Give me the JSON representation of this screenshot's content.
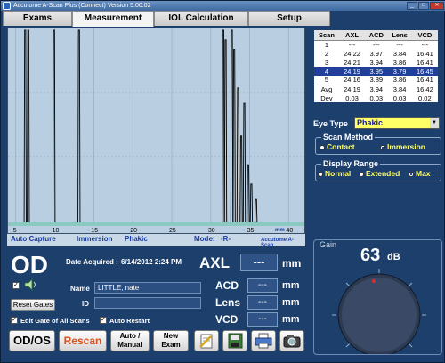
{
  "window": {
    "title": "Accutome A-Scan Plus (Connect) Version 5.00.02",
    "min_glyph": "_",
    "max_glyph": "□",
    "close_glyph": "✕"
  },
  "tabs": [
    {
      "label": "Exams",
      "active": false
    },
    {
      "label": "Measurement",
      "active": true
    },
    {
      "label": "IOL Calculation",
      "active": false
    },
    {
      "label": "Setup",
      "active": false
    }
  ],
  "waveform": {
    "x_unit": "mm",
    "x_ticks": [
      "5",
      "10",
      "15",
      "20",
      "25",
      "30",
      "35",
      "40"
    ],
    "x_range": [
      4,
      42
    ],
    "status_left": "Auto Capture",
    "status_mid1": "Immersion",
    "status_mid2": "Phakic",
    "mode_label": "Mode:",
    "mode_value": "-R-",
    "logo_text": "Accutome A-Scan"
  },
  "patient": {
    "eye": "OD",
    "date_label": "Date Acquired :",
    "date_value": "6/14/2012 2:24 PM",
    "name_label": "Name",
    "name_value": "LITTLE, nate",
    "id_label": "ID",
    "id_value": "",
    "reset_gates": "Reset Gates",
    "edit_gate": "Edit Gate of All Scans",
    "auto_restart": "Auto Restart",
    "edit_gate_checked": true,
    "auto_restart_checked": true,
    "sound_checked": true
  },
  "measurements": {
    "axl_label": "AXL",
    "axl_value": "---",
    "acd_label": "ACD",
    "acd_value": "---",
    "lens_label": "Lens",
    "lens_value": "---",
    "vcd_label": "VCD",
    "vcd_value": "---",
    "unit": "mm"
  },
  "buttons": {
    "odos": "OD/OS",
    "rescan": "Rescan",
    "auto_manual_1": "Auto /",
    "auto_manual_2": "Manual",
    "new_exam_1": "New",
    "new_exam_2": "Exam"
  },
  "scan_table": {
    "headers": [
      "Scan",
      "AXL",
      "ACD",
      "Lens",
      "VCD"
    ],
    "rows": [
      [
        "1",
        "---",
        "---",
        "---",
        "---"
      ],
      [
        "2",
        "24.22",
        "3.97",
        "3.84",
        "16.41"
      ],
      [
        "3",
        "24.21",
        "3.94",
        "3.86",
        "16.41"
      ],
      [
        "4",
        "24.19",
        "3.95",
        "3.79",
        "16.45"
      ],
      [
        "5",
        "24.16",
        "3.89",
        "3.86",
        "16.41"
      ]
    ],
    "selected_row": 3,
    "avg": [
      "Avg",
      "24.19",
      "3.94",
      "3.84",
      "16.42"
    ],
    "dev": [
      "Dev",
      "0.03",
      "0.03",
      "0.03",
      "0.02"
    ]
  },
  "eye_type": {
    "label": "Eye Type",
    "value": "Phakic"
  },
  "scan_method": {
    "title": "Scan Method",
    "contact": "Contact",
    "immersion": "Immersion",
    "selected": "immersion"
  },
  "display_range": {
    "title": "Display Range",
    "normal": "Normal",
    "extended": "Extended",
    "max": "Max",
    "selected": "max"
  },
  "gain": {
    "label": "Gain",
    "value": "63",
    "unit": "dB"
  },
  "colors": {
    "accent_blue": "#1a3ea8",
    "panel": "#1d3f6c",
    "highlight_yellow": "#ffff66",
    "rescan_orange": "#d9531e"
  },
  "icons": [
    "edit-icon",
    "save-icon",
    "print-icon",
    "camera-icon",
    "speaker-icon"
  ]
}
